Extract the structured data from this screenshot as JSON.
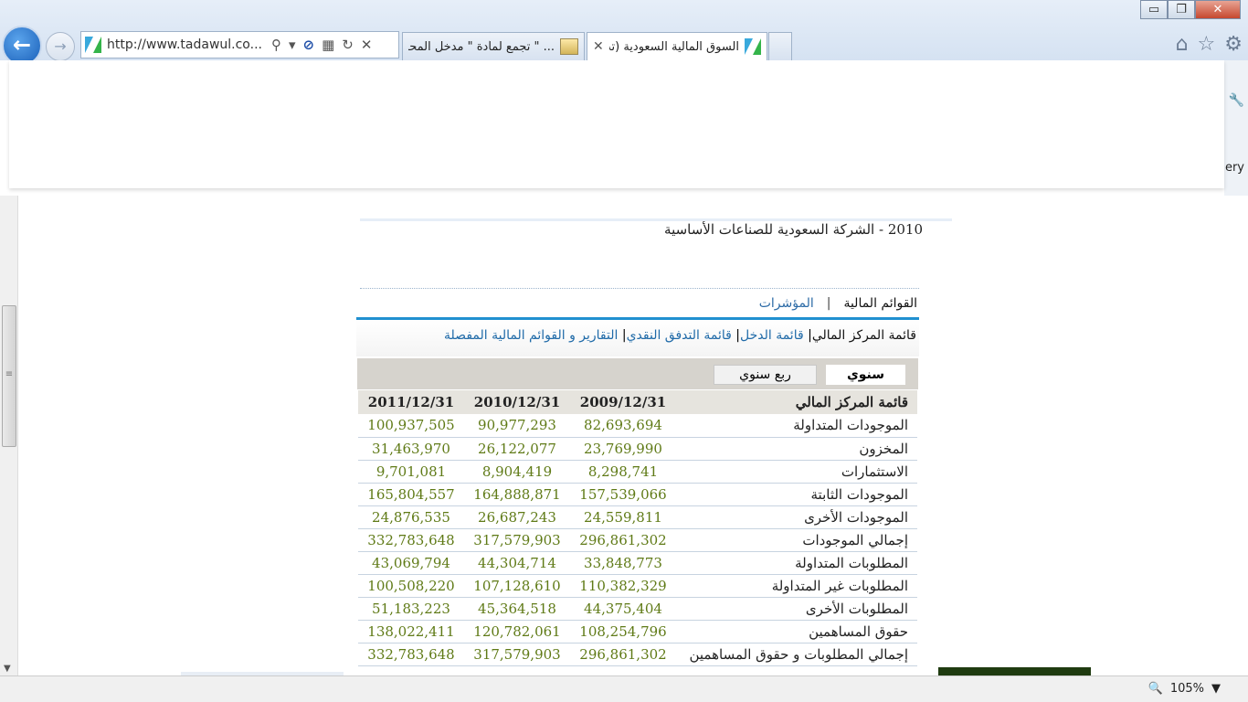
{
  "browser": {
    "url": "http://www.tadawul.co...",
    "tabs": [
      {
        "title": "... \" تجمع لمأدة \" مدخل المحاسبة"
      },
      {
        "title": "السوق المالية السعودية (تد)..."
      }
    ],
    "window_buttons": {
      "minimize": "▭",
      "restore": "❐",
      "close": "✕"
    },
    "right_panel_text": "ery",
    "zoom": "105%"
  },
  "page": {
    "company_heading": "2010 - الشركة السعودية للصناعات الأساسية",
    "menu": {
      "statements": "القوائم المالية",
      "separator": "|",
      "indicators": "المؤشرات"
    },
    "submenu": {
      "balance": "قائمة المركز المالي",
      "income": "قائمة الدخل",
      "cashflow": "قائمة التدفق النقدي",
      "reports": "التقارير و القوائم المالية المفصلة",
      "sep": "|"
    },
    "period_tabs": {
      "annual": "سنوي",
      "quarterly": "ربع سنوي"
    }
  },
  "table": {
    "header": {
      "label": "قائمة المركز المالي",
      "c1": "2009/12/31",
      "c2": "2010/12/31",
      "c3": "2011/12/31"
    },
    "rows": [
      {
        "label": "الموجودات المتداولة",
        "v1": "82,693,694",
        "v2": "90,977,293",
        "v3": "100,937,505"
      },
      {
        "label": "المخزون",
        "v1": "23,769,990",
        "v2": "26,122,077",
        "v3": "31,463,970"
      },
      {
        "label": "الاستثمارات",
        "v1": "8,298,741",
        "v2": "8,904,419",
        "v3": "9,701,081"
      },
      {
        "label": "الموجودات الثابتة",
        "v1": "157,539,066",
        "v2": "164,888,871",
        "v3": "165,804,557"
      },
      {
        "label": "الموجودات الأخرى",
        "v1": "24,559,811",
        "v2": "26,687,243",
        "v3": "24,876,535"
      },
      {
        "label": "إجمالي الموجودات",
        "v1": "296,861,302",
        "v2": "317,579,903",
        "v3": "332,783,648"
      },
      {
        "label": "المطلوبات المتداولة",
        "v1": "33,848,773",
        "v2": "44,304,714",
        "v3": "43,069,794"
      },
      {
        "label": "المطلوبات غير المتداولة",
        "v1": "110,382,329",
        "v2": "107,128,610",
        "v3": "100,508,220"
      },
      {
        "label": "المطلوبات الأخرى",
        "v1": "44,375,404",
        "v2": "45,364,518",
        "v3": "51,183,223"
      },
      {
        "label": "حقوق المساهمين",
        "v1": "108,254,796",
        "v2": "120,782,061",
        "v3": "138,022,411"
      },
      {
        "label": "إجمالي المطلوبات و حقوق المساهمين",
        "v1": "296,861,302",
        "v2": "317,579,903",
        "v3": "332,783,648"
      }
    ]
  }
}
